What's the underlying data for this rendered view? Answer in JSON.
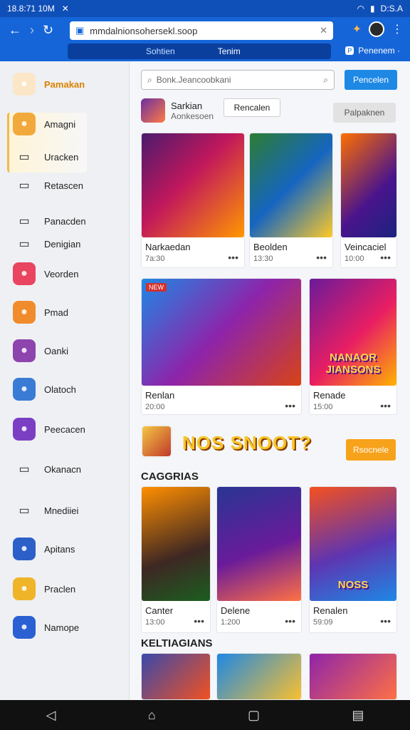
{
  "status": {
    "time": "18.8:71 10M",
    "right": "D:S.A"
  },
  "browser": {
    "url": "mmdalnionsohersekl.soop",
    "tabs": [
      "Sohtien",
      "Tenim"
    ],
    "panel_label": "Penenem ·",
    "panel_badge": "P"
  },
  "sidebar": {
    "items": [
      {
        "label": "Pamakan",
        "icon": "profile-avatar-icon",
        "color": "#fbe6c8"
      },
      {
        "label": "Amagni",
        "icon": "chat-bubble-icon",
        "color": "#f2a93b"
      },
      {
        "label": "Uracken",
        "icon": "video-camera-icon",
        "color": "transparent"
      },
      {
        "label": "Retascen",
        "icon": "controller-icon",
        "color": "transparent"
      },
      {
        "label": "Panacden",
        "icon": "envelope-icon",
        "color": "transparent"
      },
      {
        "label": "Denigian",
        "icon": "folder-icon",
        "color": "transparent"
      },
      {
        "label": "Veorden",
        "icon": "game-face-icon",
        "color": "#e94560"
      },
      {
        "label": "Pmad",
        "icon": "hero-avatar-icon",
        "color": "#f08c2c"
      },
      {
        "label": "Oanki",
        "icon": "mage-avatar-icon",
        "color": "#8e44ad"
      },
      {
        "label": "Olatoch",
        "icon": "warrior-avatar-icon",
        "color": "#3a7bd5"
      },
      {
        "label": "Peecacen",
        "icon": "purple-avatar-icon",
        "color": "#7b3fc4"
      },
      {
        "label": "Okanacn",
        "icon": "mascot-icon",
        "color": "transparent"
      },
      {
        "label": "Mnediiei",
        "icon": "people-icon",
        "color": "transparent"
      },
      {
        "label": "Apitans",
        "icon": "ninja-avatar-icon",
        "color": "#2d5fc9"
      },
      {
        "label": "Praclen",
        "icon": "trophy-icon",
        "color": "#f0b429"
      },
      {
        "label": "Namope",
        "icon": "rocket-icon",
        "color": "#2a60d1"
      }
    ]
  },
  "main": {
    "search_placeholder": "Bonk.Jeancoobkani",
    "search_button": "Pencelen",
    "profile_name": "Sarkian",
    "profile_sub": "Aonkesoen",
    "follow_button": "Rencalen",
    "grey_button": "Palpaknen",
    "row1": [
      {
        "title": "Narkaedan",
        "count": "7a:30",
        "art": "linear-gradient(135deg,#4b1a6e,#c2185b 45%,#ff9800)"
      },
      {
        "title": "Beolden",
        "count": "13:30",
        "art": "linear-gradient(135deg,#2e7d32,#1565c0 50%,#ffca28)"
      },
      {
        "title": "Veincaciel",
        "count": "10:00",
        "art": "linear-gradient(135deg,#ff6f00,#4a148c 60%,#1a237e)"
      }
    ],
    "row2": [
      {
        "title": "Renlan",
        "count": "20:00",
        "art": "linear-gradient(135deg,#1e88e5,#8e24aa 50%,#d84315)",
        "tag": "NEW"
      },
      {
        "title": "Renade",
        "count": "15:00",
        "art": "linear-gradient(135deg,#6a1b9a,#e91e63 55%,#ffb300)",
        "overlay": "NANAOR JIANSONS"
      }
    ],
    "banner_headline": "NOS SNOOT?",
    "banner_button": "Rsocnele",
    "section1": "CAGGRIAS",
    "row3": [
      {
        "title": "Canter",
        "count": "13:00",
        "art": "linear-gradient(160deg,#ff8f00,#3e2723 60%,#1b5e20)"
      },
      {
        "title": "Delene",
        "count": "1:200",
        "art": "linear-gradient(160deg,#283593,#6a1b9a 55%,#ff7043)"
      },
      {
        "title": "Renalen",
        "count": "59:09",
        "art": "linear-gradient(160deg,#f4511e,#5e35b1 55%,#1e88e5)",
        "overlay": "NOSS"
      }
    ],
    "section2": "KELTIAGIANS",
    "row4": [
      {
        "art": "linear-gradient(135deg,#3949ab,#f4511e)"
      },
      {
        "art": "linear-gradient(135deg,#1e88e5,#fbc02d)"
      },
      {
        "art": "linear-gradient(135deg,#8e24aa,#ff7043)"
      }
    ]
  }
}
